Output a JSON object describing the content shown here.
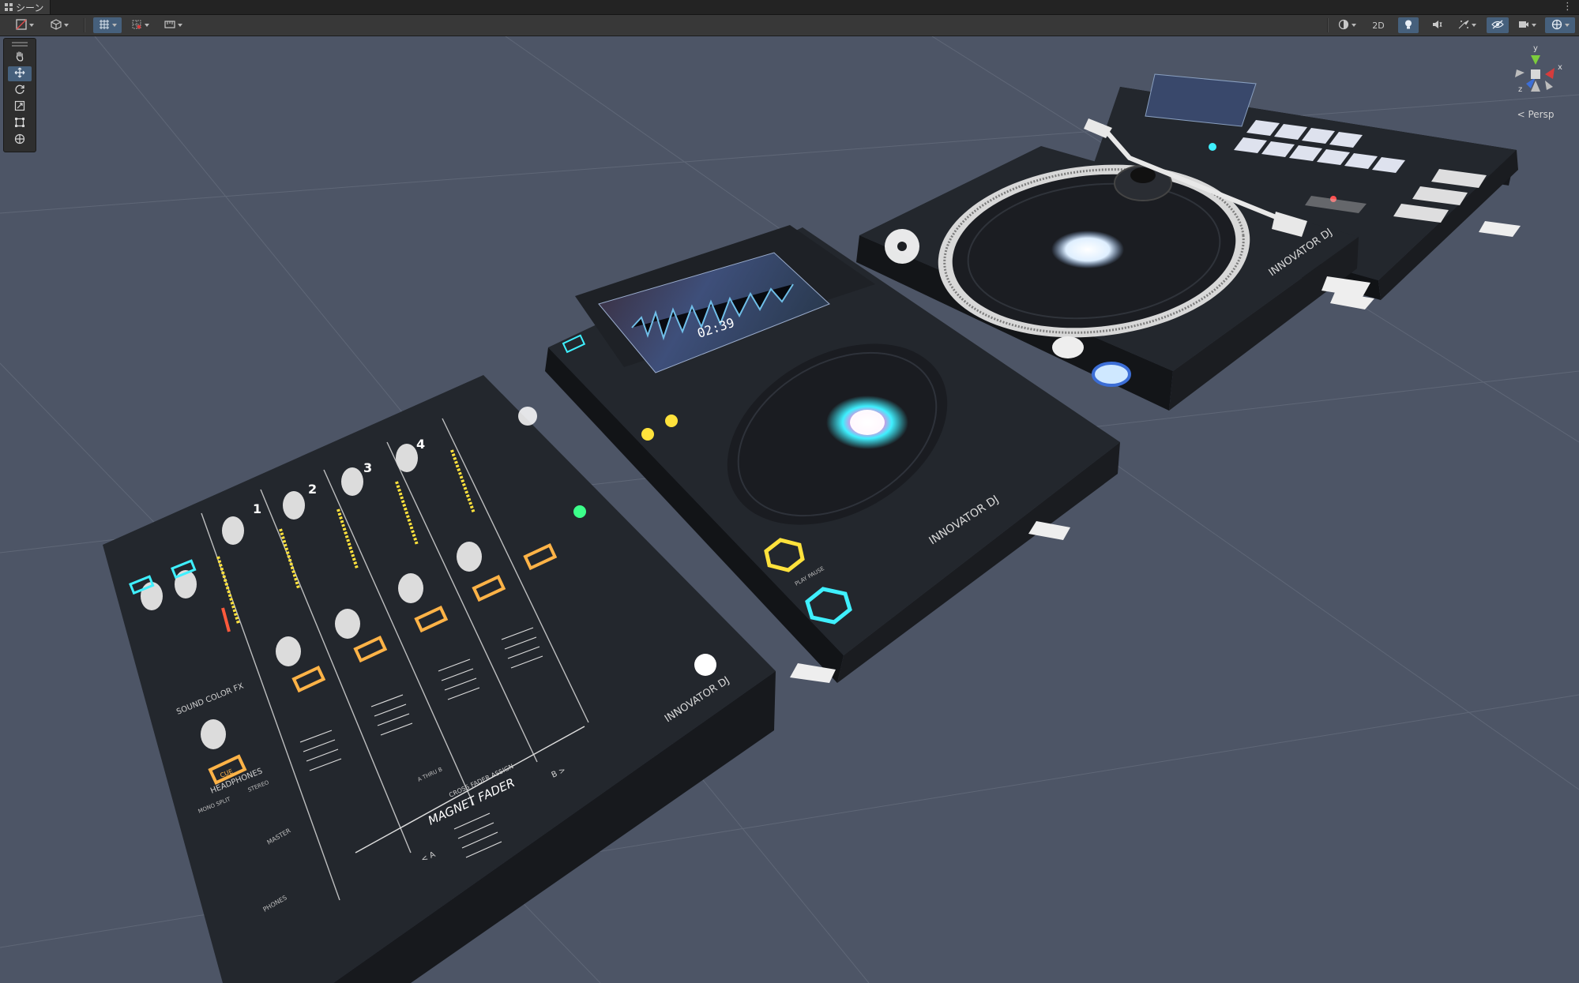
{
  "window": {
    "tab_title": "シーン",
    "tab_icon": "grid-icon",
    "tab_menu": "⋮"
  },
  "toolbar": {
    "left": [
      {
        "name": "draw-mode-icon",
        "dropdown": true
      },
      {
        "name": "orientation-icon",
        "dropdown": true
      },
      {
        "name": "grid-snap-icon",
        "dropdown": true,
        "active": true
      },
      {
        "name": "snap-increment-icon",
        "dropdown": true
      },
      {
        "name": "ruler-icon",
        "dropdown": true
      }
    ],
    "right": [
      {
        "name": "shading-mode-icon",
        "dropdown": true
      },
      {
        "name": "2d-toggle",
        "label": "2D"
      },
      {
        "name": "lighting-icon",
        "active": true
      },
      {
        "name": "audio-icon"
      },
      {
        "name": "effects-icon",
        "dropdown": true
      },
      {
        "name": "hidden-objects-icon",
        "active": true
      },
      {
        "name": "camera-icon",
        "dropdown": true
      },
      {
        "name": "gizmos-icon",
        "dropdown": true,
        "active": true
      }
    ]
  },
  "tools_panel": {
    "items": [
      {
        "name": "hand-tool",
        "icon": "hand-icon"
      },
      {
        "name": "move-tool",
        "icon": "move-icon",
        "active": true
      },
      {
        "name": "rotate-tool",
        "icon": "rotate-icon"
      },
      {
        "name": "scale-tool",
        "icon": "scale-icon"
      },
      {
        "name": "rect-tool",
        "icon": "rect-icon"
      },
      {
        "name": "transform-tool",
        "icon": "transform-icon"
      }
    ]
  },
  "gizmo": {
    "axis_x": "x",
    "axis_y": "y",
    "axis_z": "z",
    "projection": "Persp"
  },
  "scene_text": {
    "brand": "INNOVATOR DJ",
    "mixer_labels": {
      "ch1": "1",
      "ch2": "2",
      "ch3": "3",
      "ch4": "4",
      "sound_color_fx": "SOUND COLOR FX",
      "headphones": "HEADPHONES",
      "phones": "PHONES",
      "master": "MASTER",
      "mono_split": "MONO SPLIT",
      "stereo": "STEREO",
      "cue": "CUE",
      "cross_fader_assign": "CROSS FADER ASSIGN",
      "magnet_fader": "MAGNET FADER",
      "a": "< A",
      "b": "B >",
      "a_thru_b": "A THRU B"
    },
    "player_labels": {
      "time": "02:39",
      "play_pause": "PLAY PAUSE"
    }
  },
  "colors": {
    "scene_bg": "#4d5566",
    "device_top": "#23272d",
    "device_side": "#16181c",
    "accent_blue": "#46607c",
    "gizmo_x": "#d63c3c",
    "gizmo_y": "#7ccc3c",
    "gizmo_z": "#3c6ed6",
    "glow_cyan": "#3ff0ff",
    "glow_yellow": "#ffe23c",
    "glow_orange": "#ffb347",
    "glow_pink": "#ff7ad9"
  }
}
